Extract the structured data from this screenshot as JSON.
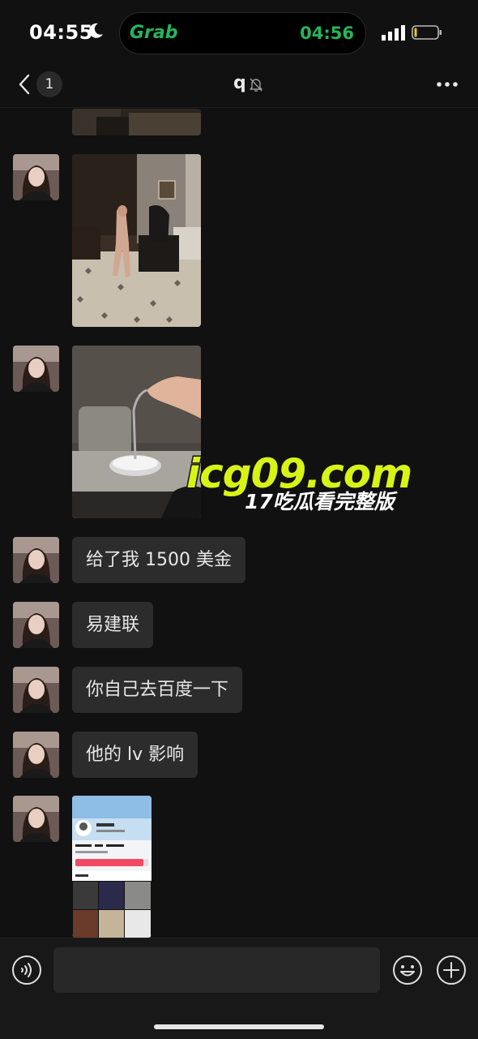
{
  "status_bar": {
    "time": "04:55",
    "island_app": "Grab",
    "island_time": "04:56"
  },
  "header": {
    "back_badge": "1",
    "title": "q"
  },
  "messages": [
    {
      "type": "image",
      "description_icon": "photo-icon"
    },
    {
      "type": "image",
      "description_icon": "photo-icon"
    },
    {
      "type": "image",
      "description_icon": "photo-icon"
    },
    {
      "type": "text",
      "text": "给了我 1500 美金"
    },
    {
      "type": "text",
      "text": "易建联"
    },
    {
      "type": "text",
      "text": "你自己去百度一下"
    },
    {
      "type": "text",
      "text": "他的 lv 影响"
    },
    {
      "type": "image",
      "description_icon": "photo-icon"
    }
  ],
  "watermark": {
    "main": "icg09.com",
    "sub": "17吃瓜看完整版"
  },
  "colors": {
    "background": "#111111",
    "bubble": "#2c2c2c",
    "grab_green": "#27b45a",
    "watermark_yellow": "#d8f316"
  }
}
